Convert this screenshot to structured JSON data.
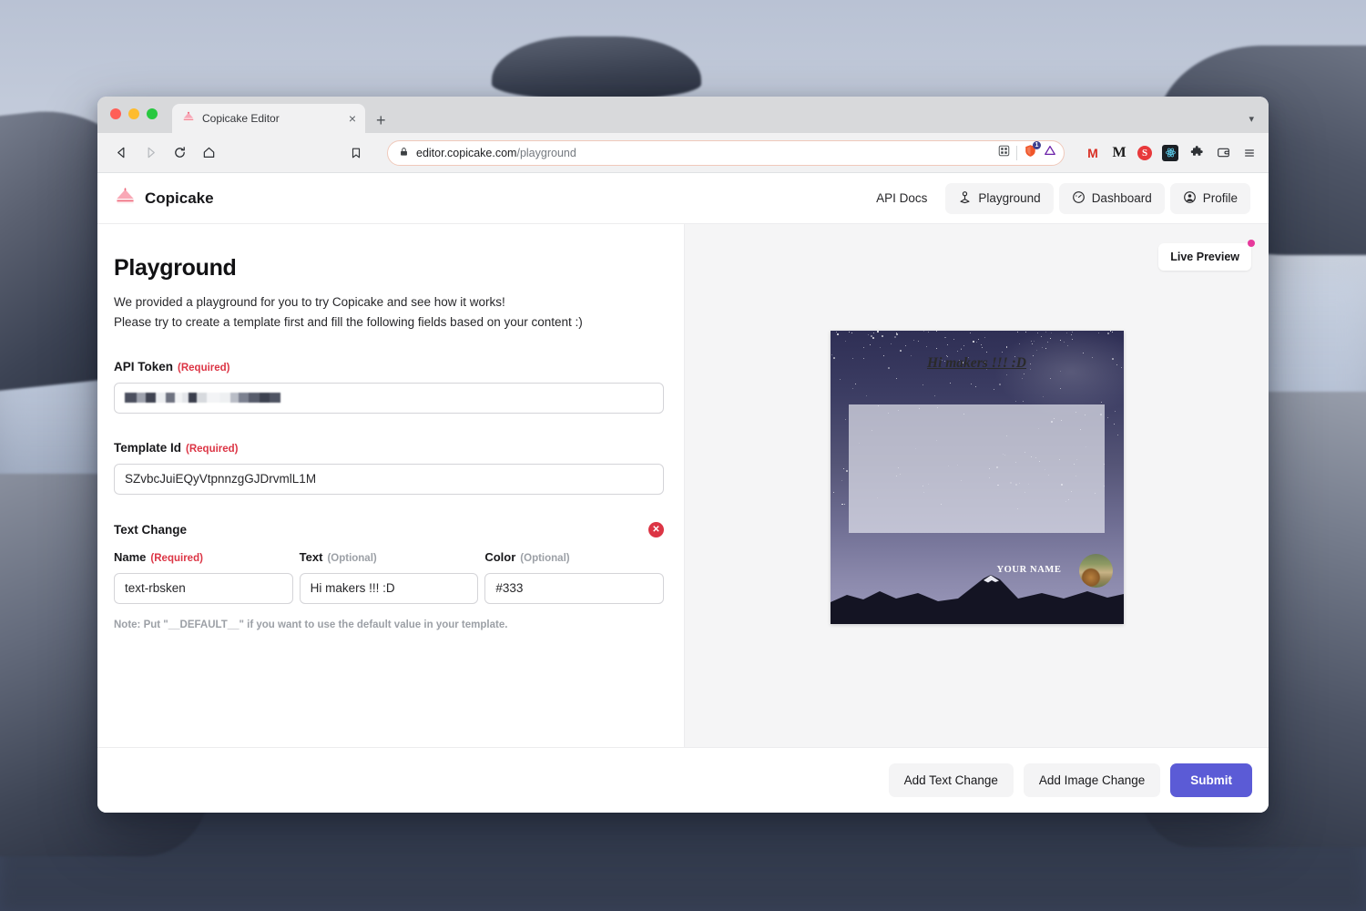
{
  "browser": {
    "tab_title": "Copicake Editor",
    "tab_favicon": "cake-slice-icon",
    "tab_close": "×",
    "new_tab": "+",
    "tabstrip_chevron": "▾",
    "url_host": "editor.copicake.com",
    "url_path": "/playground",
    "shield_badge": "1",
    "extensions": [
      {
        "name": "gmail",
        "glyph": "M"
      },
      {
        "name": "medium",
        "glyph": "M"
      },
      {
        "name": "s-badge",
        "glyph": "S"
      },
      {
        "name": "react",
        "glyph": "⚛"
      },
      {
        "name": "puzzle",
        "glyph": "🧩"
      },
      {
        "name": "profile-card",
        "glyph": "▣"
      },
      {
        "name": "menu",
        "glyph": "☰"
      }
    ]
  },
  "app": {
    "brand": "Copicake",
    "nav": [
      {
        "label": "API Docs",
        "icon": null,
        "style": "plain"
      },
      {
        "label": "Playground",
        "icon": "joystick-icon",
        "style": "filled"
      },
      {
        "label": "Dashboard",
        "icon": "gauge-icon",
        "style": "filled"
      },
      {
        "label": "Profile",
        "icon": "user-circle-icon",
        "style": "filled"
      }
    ]
  },
  "main": {
    "title": "Playground",
    "intro_line1": "We provided a playground for you to try Copicake and see how it works!",
    "intro_line2": "Please try to create a template first and fill the following fields based on your content :)",
    "api_token": {
      "label": "API Token",
      "required_tag": "(Required)",
      "value": "███ █ ██  █████",
      "redacted": true
    },
    "template_id": {
      "label": "Template Id",
      "required_tag": "(Required)",
      "value": "SZvbcJuiEQyVtpnnzgGJDrvmlL1M"
    },
    "text_change": {
      "title": "Text Change",
      "remove_glyph": "✕",
      "name": {
        "label": "Name",
        "tag": "(Required)",
        "value": "text-rbsken"
      },
      "text": {
        "label": "Text",
        "tag": "(Optional)",
        "value": "Hi makers !!! :D"
      },
      "color": {
        "label": "Color",
        "tag": "(Optional)",
        "value": "#333"
      },
      "note": "Note: Put \"__DEFAULT__\" if you want to use the default value in your template."
    }
  },
  "preview": {
    "live_preview_label": "Live Preview",
    "overlay_text": "Hi makers !!! :D",
    "your_name": "YOUR NAME",
    "badge_color": "#e6399b"
  },
  "footer": {
    "add_text_change": "Add Text Change",
    "add_image_change": "Add Image Change",
    "submit": "Submit",
    "submit_color": "#5b5bd6"
  }
}
